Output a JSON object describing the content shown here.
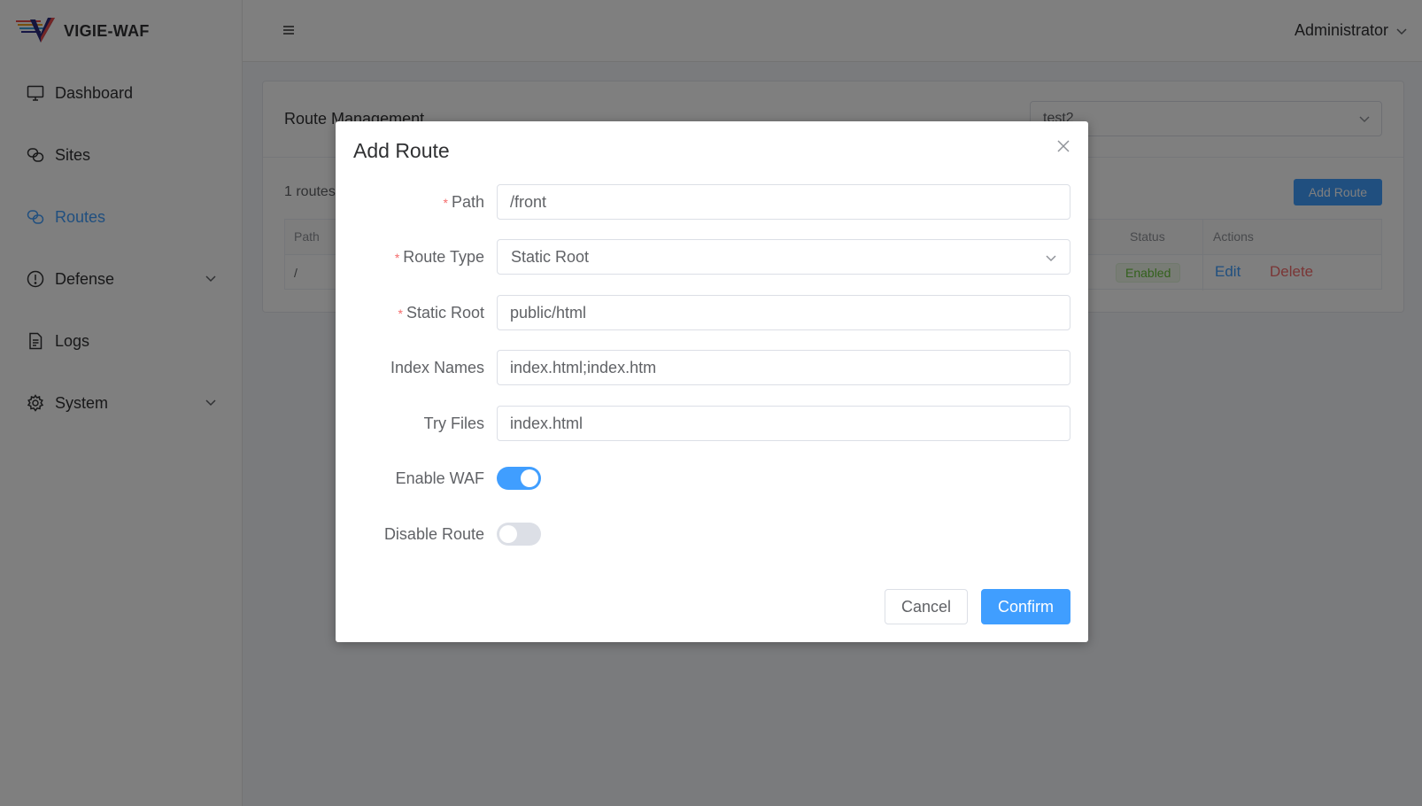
{
  "app": {
    "name": "VIGIE-WAF"
  },
  "sidebar": {
    "items": [
      {
        "label": "Dashboard",
        "icon": "monitor-icon"
      },
      {
        "label": "Sites",
        "icon": "link-icon"
      },
      {
        "label": "Routes",
        "icon": "link-icon",
        "active": true
      },
      {
        "label": "Defense",
        "icon": "warning-circle-icon",
        "expandable": true
      },
      {
        "label": "Logs",
        "icon": "document-icon"
      },
      {
        "label": "System",
        "icon": "gear-icon",
        "expandable": true
      }
    ]
  },
  "header": {
    "user": "Administrator"
  },
  "page": {
    "title": "Route Management",
    "site_selected": "test2",
    "route_count": "1 routes",
    "add_button": "Add Route",
    "table": {
      "columns": {
        "path": "Path",
        "status": "Status",
        "actions": "Actions"
      },
      "rows": [
        {
          "path": "/",
          "status": "Enabled",
          "edit": "Edit",
          "delete": "Delete"
        }
      ]
    }
  },
  "dialog": {
    "title": "Add Route",
    "fields": {
      "path": {
        "label": "Path",
        "value": "/front",
        "required": true
      },
      "route_type": {
        "label": "Route Type",
        "value": "Static Root",
        "required": true
      },
      "static_root": {
        "label": "Static Root",
        "value": "public/html",
        "required": true
      },
      "index_names": {
        "label": "Index Names",
        "value": "index.html;index.htm"
      },
      "try_files": {
        "label": "Try Files",
        "value": "index.html"
      },
      "enable_waf": {
        "label": "Enable WAF",
        "on": true
      },
      "disable_route": {
        "label": "Disable Route",
        "on": false
      }
    },
    "cancel": "Cancel",
    "confirm": "Confirm"
  },
  "colors": {
    "primary": "#409eff",
    "danger": "#f56c6c",
    "success": "#67c23a"
  }
}
